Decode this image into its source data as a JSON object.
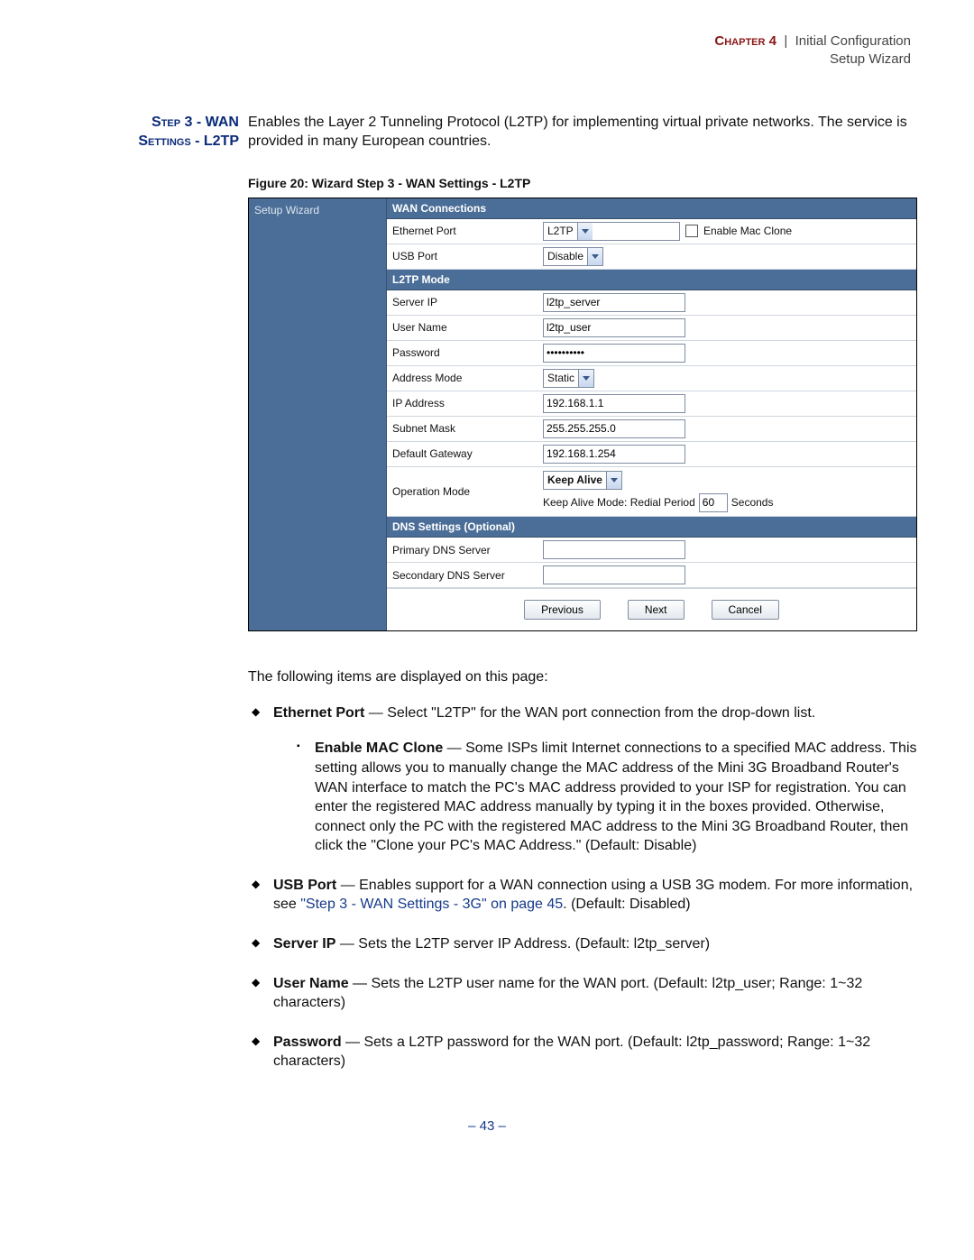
{
  "header": {
    "chapter": "Chapter 4",
    "sep": "|",
    "title1": "Initial Configuration",
    "title2": "Setup Wizard"
  },
  "section_label": {
    "line1": "Step 3 - WAN",
    "line2": "Settings - L2TP"
  },
  "intro": "Enables the Layer 2 Tunneling Protocol (L2TP) for implementing virtual private networks. The service is provided in many European countries.",
  "figure_caption": "Figure 20:  Wizard Step 3 - WAN Settings - L2TP",
  "wizard": {
    "sidebar": "Setup Wizard",
    "sections": {
      "wan_connections": "WAN Connections",
      "l2tp_mode": "L2TP Mode",
      "dns": "DNS Settings (Optional)"
    },
    "labels": {
      "ethernet_port": "Ethernet Port",
      "usb_port": "USB Port",
      "server_ip": "Server IP",
      "user_name": "User Name",
      "password": "Password",
      "address_mode": "Address Mode",
      "ip_address": "IP Address",
      "subnet_mask": "Subnet Mask",
      "default_gateway": "Default Gateway",
      "operation_mode": "Operation Mode",
      "primary_dns": "Primary DNS Server",
      "secondary_dns": "Secondary DNS Server"
    },
    "values": {
      "ethernet_port": "L2TP",
      "enable_mac_clone": "Enable Mac Clone",
      "usb_port": "Disable",
      "server_ip": "l2tp_server",
      "user_name": "l2tp_user",
      "password": "••••••••••",
      "address_mode": "Static",
      "ip_address": "192.168.1.1",
      "subnet_mask": "255.255.255.0",
      "default_gateway": "192.168.1.254",
      "operation_mode": "Keep Alive",
      "redial_label_pre": "Keep Alive Mode: Redial Period",
      "redial_value": "60",
      "redial_label_post": "Seconds",
      "primary_dns": "",
      "secondary_dns": ""
    },
    "buttons": {
      "previous": "Previous",
      "next": "Next",
      "cancel": "Cancel"
    }
  },
  "body": {
    "lead": "The following items are displayed on this page:",
    "items": {
      "ethernet_port": {
        "label": "Ethernet Port",
        "text": " — Select \"L2TP\" for the WAN port connection from the drop-down list."
      },
      "enable_mac_clone": {
        "label": "Enable MAC Clone",
        "text": " — Some ISPs limit Internet connections to a specified MAC address. This setting allows you to manually change the MAC address of the Mini 3G Broadband Router's WAN interface to match the PC's MAC address provided to your ISP for registration. You can enter the registered MAC address manually by typing it in the boxes provided. Otherwise, connect only the PC with the registered MAC address to the Mini 3G Broadband Router, then click the \"Clone your PC's MAC Address.\" (Default: Disable)"
      },
      "usb_port": {
        "label": "USB Port",
        "text_pre": " — Enables support for a WAN connection using a USB 3G modem. For more information, see ",
        "xref": "\"Step 3 - WAN Settings - 3G\" on page 45",
        "text_post": ". (Default: Disabled)"
      },
      "server_ip": {
        "label": "Server IP",
        "text": " — Sets the L2TP server IP Address. (Default: l2tp_server)"
      },
      "user_name": {
        "label": "User Name",
        "text": " — Sets the L2TP user name for the WAN port. (Default: l2tp_user; Range: 1~32 characters)"
      },
      "password": {
        "label": "Password",
        "text": " — Sets a L2TP password for the WAN port. (Default: l2tp_password; Range: 1~32 characters)"
      }
    }
  },
  "page_number": "– 43 –"
}
